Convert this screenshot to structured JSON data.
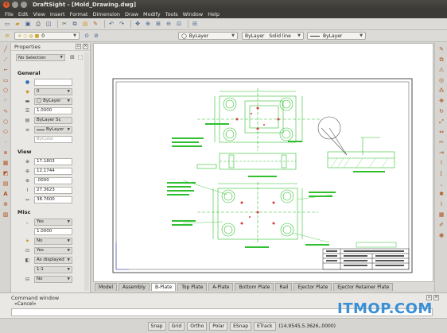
{
  "window": {
    "title": "DraftSight - [Mold_Drawing.dwg]",
    "buttons": [
      "close",
      "minimize",
      "maximize"
    ]
  },
  "menu": {
    "items": [
      "File",
      "Edit",
      "View",
      "Insert",
      "Format",
      "Dimension",
      "Draw",
      "Modify",
      "Tools",
      "Window",
      "Help"
    ]
  },
  "toolbar": {
    "layer_value": "0",
    "color_value": "ByLayer",
    "linetype_value": "ByLayer",
    "linetype_style": "Solid line",
    "lineweight_value": "ByLayer"
  },
  "properties": {
    "title": "Properties",
    "selection": "No Selection",
    "general": {
      "title": "General",
      "fields": [
        "",
        "0",
        "ByLayer",
        "1.0000",
        "ByLayer Sc",
        "ByLayer",
        "ByColor"
      ]
    },
    "view": {
      "title": "View",
      "fields": [
        "17.1803",
        "12.1744",
        ".0000",
        "27.3623",
        "38.7600"
      ]
    },
    "misc": {
      "title": "Misc",
      "fields": [
        "Yes",
        "1.0000",
        "No",
        "Yes",
        "As displayed",
        "1:1",
        "No"
      ]
    }
  },
  "tabs": [
    "Model",
    "Assembly",
    "B-Plate",
    "Top Plate",
    "A-Plate",
    "Bottom Plate",
    "Rail",
    "Ejector Plate",
    "Ejector Retainer Plate"
  ],
  "active_tab": "B-Plate",
  "command_window": {
    "title": "Command window",
    "text": "«Cancel»"
  },
  "status": {
    "buttons": [
      "Snap",
      "Grid",
      "Ortho",
      "Polar",
      "ESnap",
      "ETrack"
    ],
    "coords": "(14.9545,5.3626,.0000)"
  },
  "watermark": "ITMOP.COM",
  "colors": {
    "drawing_green": "#2fbf2f",
    "drawing_red": "#d23b3b",
    "menu_bg": "#3c3b37",
    "watermark": "#3a8fd6"
  }
}
